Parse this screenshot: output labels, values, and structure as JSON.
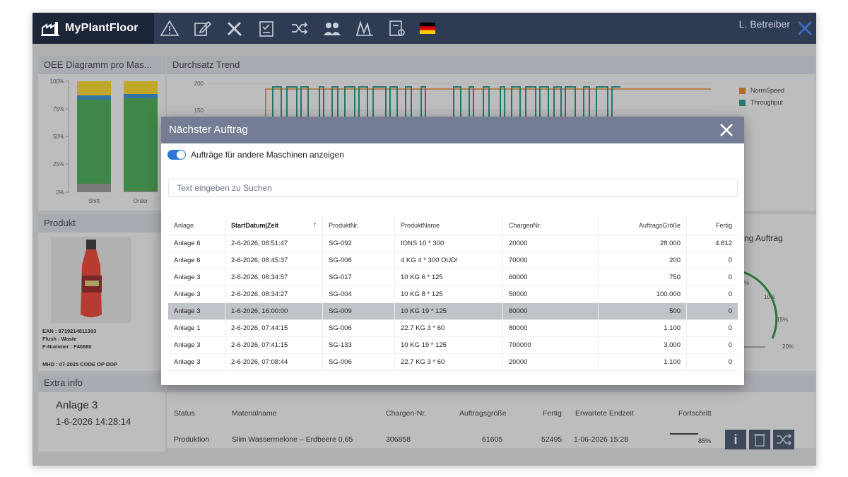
{
  "app": {
    "brand": "MyPlantFloor",
    "user": "L. Betreiber"
  },
  "nav_icons": [
    "warning-icon",
    "edit-icon",
    "tools-icon",
    "checklist-icon",
    "shuffle-icon",
    "users-icon",
    "chart-icon",
    "settings-doc-icon",
    "german-flag-icon"
  ],
  "panels": {
    "oee_title": "OEE Diagramm pro Mas...",
    "oee_ticks": [
      "100%",
      "75%",
      "50%",
      "25%",
      "0%"
    ],
    "oee_categories": [
      "Shift",
      "Order"
    ],
    "trend_title": "Durchsatz Trend",
    "trend_ticks": [
      "200",
      "150"
    ],
    "trend_legend": [
      "NormSpeed",
      "Throughput"
    ],
    "product_title": "Produkt",
    "product_lines": [
      "EAN : 8719214811303",
      "Flush : Waste",
      "F-Nummer : F40880",
      "MHD : 07-2025 CODE OP DOP"
    ],
    "extra_title": "Extra info",
    "extra_machine": "Anlage 3",
    "extra_time": "1-6-2026 14:28:14",
    "gauge_title": "ng Auftrag",
    "gauge_labels": [
      "%",
      "10%",
      "15%",
      "20%"
    ]
  },
  "machine_data": {
    "headers": [
      "Status",
      "Materialname",
      "Chargen-Nr.",
      "Auftragsgröße",
      "Fertig",
      "Erwartete Endzeit",
      "Fortschritt"
    ],
    "row": {
      "status": "Produktion",
      "material": "Slim Wassermelone – Erdbeere 0,65",
      "charge": "306858",
      "size": "61605",
      "done": "52495",
      "end": "1-06-2026 15:28",
      "progress": "85%"
    }
  },
  "modal": {
    "title": "Nächster Auftrag",
    "toggle_label": "Aufträge für andere Maschinen anzeigen",
    "search_placeholder": "Text eingeben zu Suchen",
    "columns": [
      "Anlage",
      "StartDatum|Zeit",
      "ProduktNr.",
      "ProduktName",
      "ChargenNr.",
      "AuftragsGröße",
      "Fertig"
    ],
    "sort_indicator": "↑",
    "rows": [
      [
        "Anlage 6",
        "2-6-2026, 08:51:47",
        "SG-092",
        "IONS 10 * 300",
        "20000",
        "28.000",
        "4.812"
      ],
      [
        "Anlage 6",
        "2-6-2026, 08:45:37",
        "SG-006",
        "4 KG 4 * 300 OUD!",
        "70000",
        "200",
        "0"
      ],
      [
        "Anlage 3",
        "2-6-2026, 08:34:57",
        "SG-017",
        "10 KG 6 * 125",
        "60000",
        "750",
        "0"
      ],
      [
        "Anlage 3",
        "2-6-2026, 08:34:27",
        "SG-004",
        "10 KG 8 * 125",
        "50000",
        "100.000",
        "0"
      ],
      [
        "Anlage 3",
        "1-6-2026, 16:00:00",
        "SG-009",
        "10 KG 19 * 125",
        "80000",
        "500",
        "0"
      ],
      [
        "Anlage 1",
        "2-6-2026, 07:44:15",
        "SG-006",
        "22.7 KG 3 * 60",
        "80000",
        "1.100",
        "0"
      ],
      [
        "Anlage 3",
        "2-6-2026, 07:41:15",
        "SG-133",
        "10 KG 19 * 125",
        "700000",
        "3.000",
        "0"
      ],
      [
        "Anlage 3",
        "2-6-2026, 07:08:44",
        "SG-006",
        "22.7 KG 3 * 60",
        "20000",
        "1.100",
        "0"
      ]
    ],
    "selected_row": 4
  },
  "colors": {
    "topbar": "#2f3b52",
    "modal_header": "#747d93",
    "normspeed": "#e07b1a",
    "throughput": "#1c8a7c",
    "oee_green": "#3ea14a",
    "oee_yellow": "#f2cd1d",
    "oee_blue": "#2a86c8"
  }
}
